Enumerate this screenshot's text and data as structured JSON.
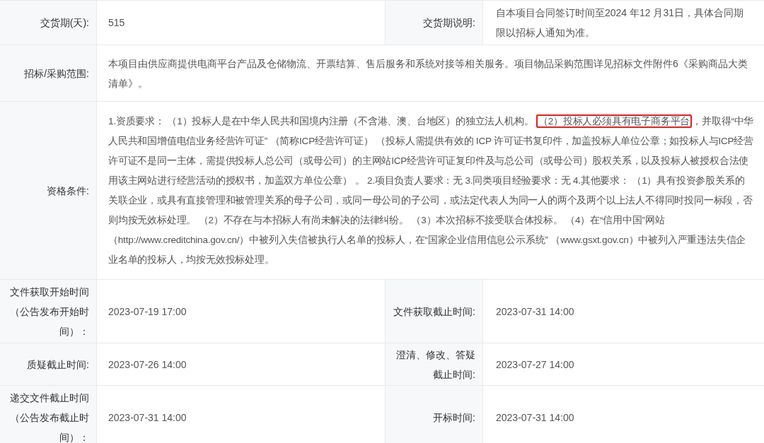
{
  "rows": [
    {
      "kind": "pair",
      "fields": [
        {
          "label": "交货期(天):",
          "value": "515"
        },
        {
          "label": "交货期说明:",
          "value": "自本项目合同签订时间至2024 年12 月31日，具体合同期限以招标人通知为准。"
        }
      ]
    },
    {
      "kind": "wide",
      "fields": [
        {
          "label": "招标/采购范围:",
          "value": "本项目由供应商提供电商平台产品及仓储物流、开票结算、售后服务和系统对接等相关服务。项目物品采购范围详见招标文件附件6《采购商品大类清单》。"
        }
      ]
    },
    {
      "kind": "highlighted",
      "fields": [
        {
          "label": "资格条件:",
          "before": "1.资质要求：  （1）投标人是在中华人民共和国境内注册（不含港、澳、台地区）的独立法人机构。 ",
          "highlight": "（2）投标人必须具有电子商务平台",
          "after": "，并取得“中华人民共和国增值电信业务经营许可证” （简称ICP经营许可证） （投标人需提供有效的 ICP 许可证书复印件，加盖投标人单位公章；如投标人与ICP经营许可证不是同一主体，需提供投标人总公司（或母公司）的主网站ICP经营许可证复印件及与总公司（或母公司）股权关系，以及投标人被授权合法使用该主网站进行经营活动的授权书，加盖双方单位公章） 。 2.项目负责人要求：无 3.同类项目经验要求：无 4.其他要求：  （1）具有投资参股关系的关联企业，或具有直接管理和被管理关系的母子公司，或同一母公司的子公司，或法定代表人为同一人的两个及两个以上法人不得同时投同一标段，否则均按无效标处理。 （2）不存在与本招标人有尚未解决的法律纠纷。 （3）本次招标不接受联合体投标。 （4）在“信用中国”网站（http://www.creditchina.gov.cn/）中被列入失信被执行人名单的投标人，在“国家企业信用信息公示系统” （www.gsxt.gov.cn）中被列入严重违法失信企业名单的投标人，均按无效投标处理。"
        }
      ]
    },
    {
      "kind": "pair",
      "fields": [
        {
          "label": "文件获取开始时间（公告发布开始时间）：",
          "value": "2023-07-19 17:00"
        },
        {
          "label": "文件获取截止时间:",
          "value": "2023-07-31 14:00"
        }
      ]
    },
    {
      "kind": "pair",
      "fields": [
        {
          "label": "质疑截止时间:",
          "value": "2023-07-26 14:00"
        },
        {
          "label": "澄清、修改、答疑截止时间:",
          "value": "2023-07-27 14:00"
        }
      ]
    },
    {
      "kind": "pair",
      "fields": [
        {
          "label": "递交文件截止时间（公告发布截止时间）：",
          "value": "2023-07-31 14:00"
        },
        {
          "label": "开标时间:",
          "value": "2023-07-31 14:00"
        }
      ]
    }
  ]
}
